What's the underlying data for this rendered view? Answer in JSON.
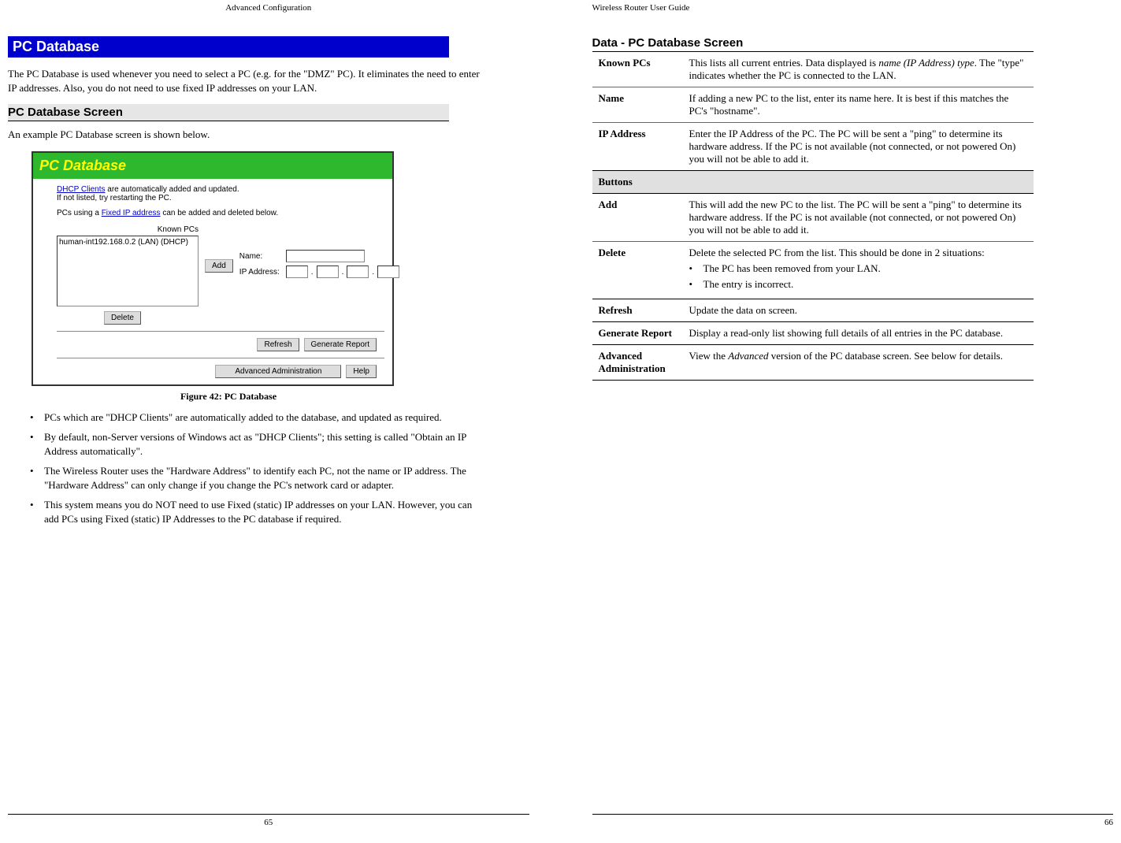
{
  "left": {
    "header": "Advanced Configuration",
    "pagenum": "65",
    "section_title": "PC Database",
    "intro": "The PC Database is used whenever you need to select a PC (e.g. for the \"DMZ\" PC). It eliminates the need to enter IP addresses. Also, you do not need to use fixed IP addresses on your LAN.",
    "sub_heading": "PC Database Screen",
    "example_line": "An example PC Database screen is shown below.",
    "figure_caption": "Figure 42: PC Database",
    "bullets": [
      "PCs which are \"DHCP Clients\" are automatically added to the database, and updated as required.",
      "By default, non-Server versions of Windows act as \"DHCP Clients\"; this setting is called \"Obtain an IP Address automatically\".",
      "The Wireless Router uses the \"Hardware Address\" to identify each PC, not the name or IP address. The \"Hardware Address\" can only change if you change the PC's network card or adapter.",
      "This system means you do NOT need to use Fixed (static) IP addresses on your LAN. However, you can add PCs using Fixed (static) IP Addresses to the PC database if required."
    ],
    "shot": {
      "title": "PC Database",
      "line1_pre": "DHCP Clients",
      "line1_post": " are automatically added and updated.",
      "line2": "If not listed, try restarting the PC.",
      "line3_pre": "PCs using a ",
      "line3_link": "Fixed IP address",
      "line3_post": " can be added and deleted below.",
      "known_label": "Known PCs",
      "list_item": "human-int192.168.0.2 (LAN) (DHCP)",
      "btn_add": "Add",
      "name_label": "Name:",
      "ip_label": "IP Address:",
      "btn_delete": "Delete",
      "btn_refresh": "Refresh",
      "btn_generate": "Generate Report",
      "btn_advanced": "Advanced Administration",
      "btn_help": "Help"
    }
  },
  "right": {
    "header": "Wireless Router User Guide",
    "pagenum": "66",
    "heading": "Data - PC Database Screen",
    "rows": {
      "known_label": "Known PCs",
      "known_text_a": "This lists all current entries. Data displayed is ",
      "known_text_i": "name (IP Address) type",
      "known_text_b": ". The \"type\" indicates whether the PC is connected to the LAN.",
      "name_label": "Name",
      "name_text": "If adding a new PC to the list, enter its name here. It is best if this matches the PC's \"hostname\".",
      "ip_label": "IP Address",
      "ip_text": "Enter the IP Address of the PC. The PC will be sent a \"ping\" to determine its hardware address. If the PC is not available (not connected, or not powered On) you will not be able to add it.",
      "buttons_section": "Buttons",
      "add_label": "Add",
      "add_text": "This will add the new PC to the list. The PC will be sent a \"ping\" to determine its hardware address. If the PC is not available (not connected, or not powered On) you will not be able to add it.",
      "del_label": "Delete",
      "del_text": "Delete the selected PC from the list. This should be done in 2 situations:",
      "del_b1": "The PC has been removed from your LAN.",
      "del_b2": "The entry is incorrect.",
      "ref_label": "Refresh",
      "ref_text": "Update the data on screen.",
      "gen_label": "Generate Report",
      "gen_text": "Display a read-only list showing full details of all entries in the PC database.",
      "adv_label": "Advanced Administration",
      "adv_text_a": "View the ",
      "adv_text_i": "Advanced",
      "adv_text_b": " version of the PC database screen. See below for details."
    }
  }
}
